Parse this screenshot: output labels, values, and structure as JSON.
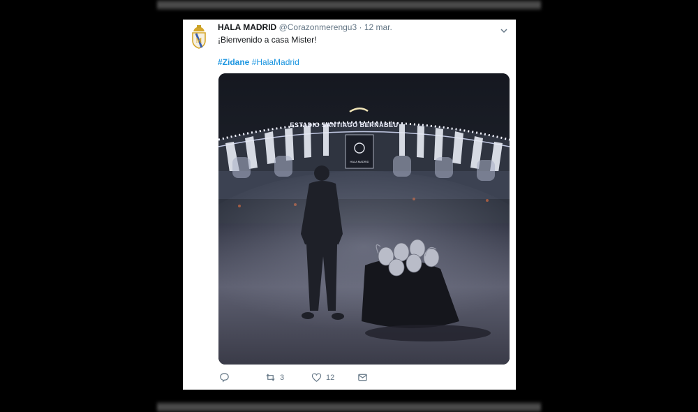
{
  "tweet": {
    "display_name": "HALA MADRID",
    "handle": "@Corazonmerengu3",
    "separator": "·",
    "date": "12 mar.",
    "text": "¡Bienvenido a casa Mister!",
    "hashtags": [
      "#Zidane",
      "#HalaMadrid"
    ],
    "media": {
      "stadium_sign": "ESTADIO SANTIAGO BERNABÉU",
      "banner_text": "HALA MADRID"
    },
    "actions": {
      "reply_icon": "reply-icon",
      "retweet_icon": "retweet-icon",
      "retweet_count": "3",
      "like_icon": "heart-icon",
      "like_count": "12",
      "dm_icon": "envelope-icon"
    }
  },
  "colors": {
    "link": "#1b95e0",
    "secondary_text": "#657786",
    "primary_text": "#14171a",
    "background": "#000000"
  }
}
